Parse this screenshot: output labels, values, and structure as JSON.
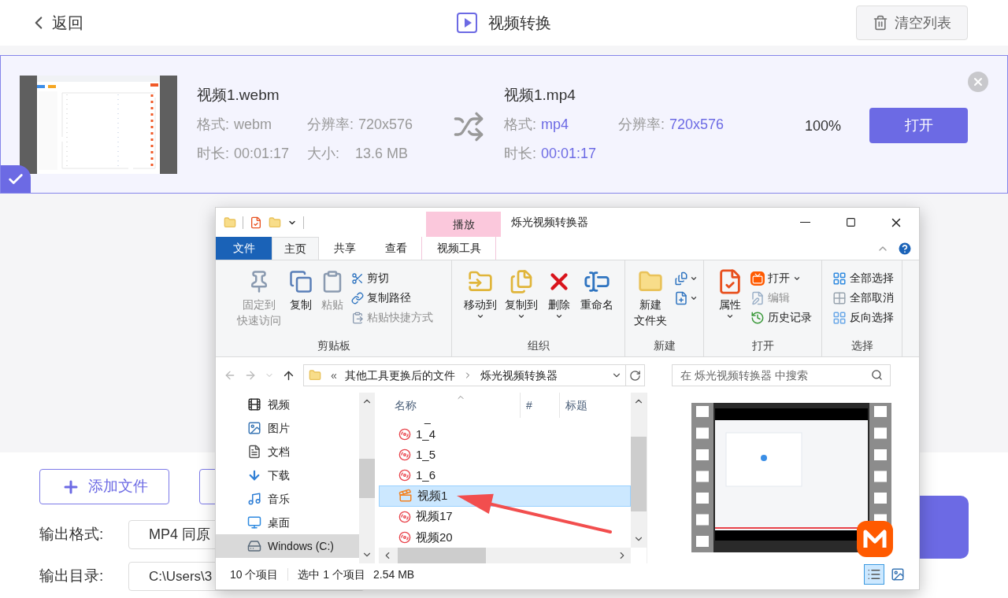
{
  "header": {
    "back": "返回",
    "title": "视频转换",
    "clear_button": "清空列表"
  },
  "file_card": {
    "checked": true,
    "source": {
      "name": "视频1.webm",
      "format_label": "格式:",
      "format": "webm",
      "resolution_label": "分辨率:",
      "resolution": "720x576",
      "duration_label": "时长:",
      "duration": "00:01:17",
      "size_label": "大小:",
      "size": "13.6 MB"
    },
    "target": {
      "name": "视频1.mp4",
      "format_label": "格式:",
      "format": "mp4",
      "resolution_label": "分辨率:",
      "resolution": "720x576",
      "duration_label": "时长:",
      "duration": "00:01:17"
    },
    "progress": "100%",
    "open_button": "打开"
  },
  "output": {
    "add_file_button": "添加文件",
    "format_label": "输出格式:",
    "format": "MP4 同原",
    "folder_label": "输出目录:",
    "folder": "C:\\Users\\3"
  },
  "explorer": {
    "title": "烁光视频转换器",
    "context_label": "播放",
    "tabs": [
      {
        "label": "文件",
        "kind": "file",
        "selected": false
      },
      {
        "label": "主页",
        "kind": "tab",
        "selected": true
      },
      {
        "label": "共享",
        "kind": "tab",
        "selected": false
      },
      {
        "label": "查看",
        "kind": "tab",
        "selected": false
      },
      {
        "label": "视频工具",
        "kind": "context",
        "selected": false
      }
    ],
    "ribbon_groups": [
      {
        "label": "剪贴板",
        "items": [
          {
            "kind": "large",
            "lines": [
              "固定到",
              "快速访问"
            ],
            "disabled": true,
            "dropdown": false
          },
          {
            "kind": "large",
            "lines": [
              "复制"
            ],
            "disabled": false,
            "dropdown": false
          },
          {
            "kind": "large",
            "lines": [
              "粘贴"
            ],
            "disabled": true,
            "dropdown": false
          },
          {
            "kind": "small",
            "label": "剪切",
            "disabled": false,
            "dropdown": false
          },
          {
            "kind": "small",
            "label": "复制路径",
            "disabled": false,
            "dropdown": false
          },
          {
            "kind": "small",
            "label": "粘贴快捷方式",
            "disabled": true,
            "dropdown": false
          }
        ]
      },
      {
        "label": "组织",
        "items": [
          {
            "kind": "large",
            "lines": [
              "移动到"
            ],
            "disabled": false,
            "dropdown": true
          },
          {
            "kind": "large",
            "lines": [
              "复制到"
            ],
            "disabled": false,
            "dropdown": true
          },
          {
            "kind": "large",
            "lines": [
              "删除"
            ],
            "disabled": false,
            "dropdown": true
          },
          {
            "kind": "large",
            "lines": [
              "重命名"
            ],
            "disabled": false,
            "dropdown": false
          }
        ]
      },
      {
        "label": "新建",
        "items": [
          {
            "kind": "large",
            "lines": [
              "新建",
              "文件夹"
            ],
            "disabled": false,
            "dropdown": false
          },
          {
            "kind": "icon",
            "disabled": false,
            "dropdown": true
          },
          {
            "kind": "icon",
            "disabled": false,
            "dropdown": true
          }
        ]
      },
      {
        "label": "打开",
        "items": [
          {
            "kind": "large",
            "lines": [
              "属性"
            ],
            "disabled": false,
            "dropdown": true
          },
          {
            "kind": "small",
            "label": "打开",
            "disabled": false,
            "dropdown": true
          },
          {
            "kind": "small",
            "label": "编辑",
            "disabled": true,
            "dropdown": false
          },
          {
            "kind": "small",
            "label": "历史记录",
            "disabled": false,
            "dropdown": false
          }
        ]
      },
      {
        "label": "选择",
        "items": [
          {
            "kind": "small",
            "label": "全部选择",
            "disabled": false,
            "dropdown": false
          },
          {
            "kind": "small",
            "label": "全部取消",
            "disabled": false,
            "dropdown": false
          },
          {
            "kind": "small",
            "label": "反向选择",
            "disabled": false,
            "dropdown": false
          }
        ]
      }
    ],
    "address": {
      "overflow": "«",
      "path": [
        "其他工具更换后的文件",
        "烁光视频转换器"
      ]
    },
    "search_placeholder": "在 烁光视频转换器 中搜索",
    "nav": [
      {
        "label": "视频",
        "selected": false
      },
      {
        "label": "图片",
        "selected": false
      },
      {
        "label": "文档",
        "selected": false
      },
      {
        "label": "下载",
        "selected": false
      },
      {
        "label": "音乐",
        "selected": false
      },
      {
        "label": "桌面",
        "selected": false
      },
      {
        "label": "Windows (C:)",
        "selected": true
      }
    ],
    "columns": [
      "名称",
      "#",
      "标题"
    ],
    "files": [
      {
        "name": "_",
        "kind": "partial",
        "selected": false
      },
      {
        "name": "1_4",
        "kind": "media",
        "selected": false
      },
      {
        "name": "1_5",
        "kind": "media",
        "selected": false
      },
      {
        "name": "1_6",
        "kind": "media",
        "selected": false
      },
      {
        "name": "视频1",
        "kind": "video",
        "selected": true
      },
      {
        "name": "视频17",
        "kind": "media",
        "selected": false
      },
      {
        "name": "视频20",
        "kind": "media",
        "selected": false
      }
    ],
    "status": {
      "count": "10 个项目",
      "selection": "选中 1 个项目",
      "size": "2.54 MB"
    },
    "views": [
      {
        "kind": "details",
        "selected": true
      },
      {
        "kind": "thumbnails",
        "selected": false
      }
    ]
  }
}
